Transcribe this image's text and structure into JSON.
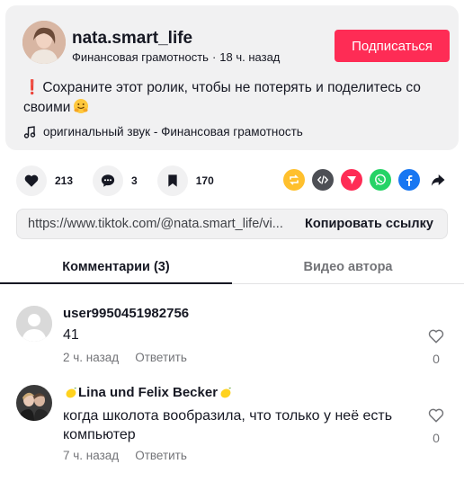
{
  "post": {
    "username": "nata.smart_life",
    "author_name": "Финансовая грамотность",
    "separator": "·",
    "time_ago": "18 ч. назад",
    "follow_label": "Подписаться",
    "description_emoji": "❗",
    "description": "Сохраните этот ролик, чтобы не потерять и поделитесь со своими",
    "music": "оригинальный звук - Финансовая грамотность"
  },
  "actions": {
    "likes": "213",
    "comments": "3",
    "saves": "170"
  },
  "share": {
    "icons": [
      "repost-icon",
      "embed-icon",
      "send-icon",
      "whatsapp-icon",
      "facebook-icon",
      "share-arrow-icon"
    ]
  },
  "link": {
    "url": "https://www.tiktok.com/@nata.smart_life/vi...",
    "copy_label": "Копировать ссылку"
  },
  "tabs": {
    "comments": "Комментарии (3)",
    "author_videos": "Видео автора"
  },
  "comments": [
    {
      "username": "user9950451982756",
      "text": "41",
      "time": "2 ч. назад",
      "reply": "Ответить",
      "likes": "0"
    },
    {
      "username": "Lina und Felix Becker",
      "text": "когда школота вообразила, что только у неё есть компьютер",
      "time": "7 ч. назад",
      "reply": "Ответить",
      "likes": "0"
    }
  ],
  "colors": {
    "accent": "#fe2c55",
    "background_card": "#f1f1f2",
    "text_primary": "#161823",
    "text_secondary": "#737478"
  }
}
